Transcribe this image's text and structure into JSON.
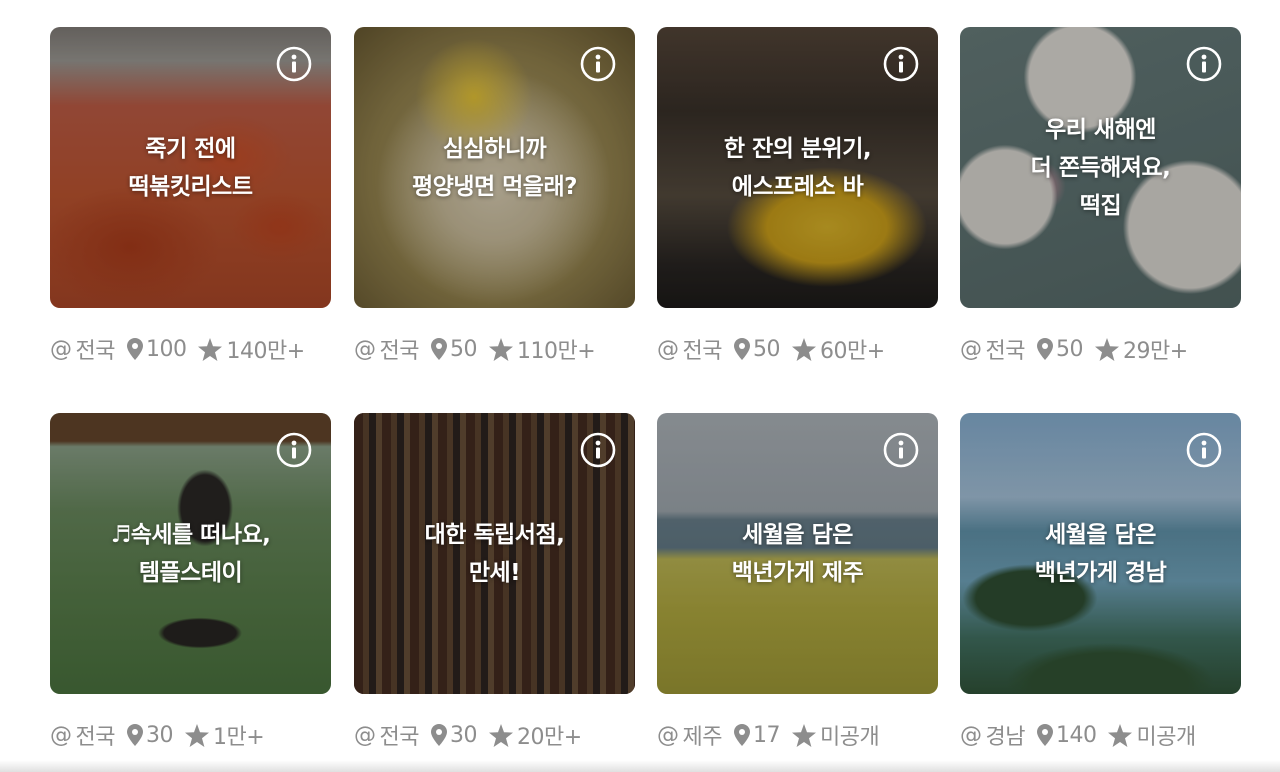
{
  "cards": [
    {
      "title": "죽기 전에\n떡볶킷리스트",
      "region": "전국",
      "places": "100",
      "saves": "140만+"
    },
    {
      "title": "심심하니까\n평양냉면 먹을래?",
      "region": "전국",
      "places": "50",
      "saves": "110만+"
    },
    {
      "title": "한 잔의 분위기,\n에스프레소 바",
      "region": "전국",
      "places": "50",
      "saves": "60만+"
    },
    {
      "title": "우리 새해엔\n더 쫀득해져요,\n떡집",
      "region": "전국",
      "places": "50",
      "saves": "29만+"
    },
    {
      "title": "♬속세를 떠나요,\n템플스테이",
      "region": "전국",
      "places": "30",
      "saves": "1만+"
    },
    {
      "title": "대한 독립서점,\n만세!",
      "region": "전국",
      "places": "30",
      "saves": "20만+"
    },
    {
      "title": "세월을 담은\n백년가게 제주",
      "region": "제주",
      "places": "17",
      "saves": "미공개"
    },
    {
      "title": "세월을 담은\n백년가게 경남",
      "region": "경남",
      "places": "140",
      "saves": "미공개"
    }
  ],
  "at_symbol": "@",
  "icons": {
    "info": "info-circle-icon",
    "location": "location-pin-icon",
    "rating": "star-icon"
  },
  "colors": {
    "meta_text": "#8d8d8d",
    "icon": "#8d8d8d",
    "title_text": "#ffffff"
  }
}
